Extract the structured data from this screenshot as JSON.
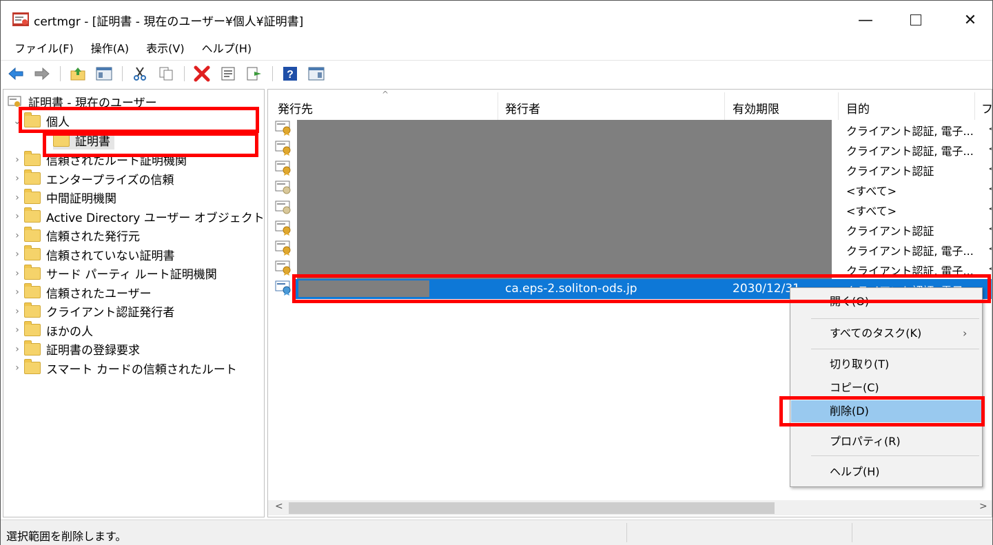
{
  "window": {
    "title": "certmgr - [証明書 - 現在のユーザー¥個人¥証明書]",
    "min_glyph": "—",
    "close_glyph": "✕"
  },
  "menu": [
    "ファイル(F)",
    "操作(A)",
    "表示(V)",
    "ヘルプ(H)"
  ],
  "toolbar": {
    "icons": [
      "back-arrow-icon",
      "forward-arrow-icon",
      "up-folder-icon",
      "show-hide-tree-icon",
      "cut-icon",
      "copy-icon",
      "delete-icon",
      "properties-icon",
      "export-icon",
      "help-icon",
      "console-icon"
    ]
  },
  "tree": {
    "root": "証明書 - 現在のユーザー",
    "expanded": "個人",
    "child": "証明書",
    "items": [
      "信頼されたルート証明機関",
      "エンタープライズの信頼",
      "中間証明機関",
      "Active Directory ユーザー オブジェクト",
      "信頼された発行元",
      "信頼されていない証明書",
      "サード パーティ ルート証明機関",
      "信頼されたユーザー",
      "クライアント認証発行者",
      "ほかの人",
      "証明書の登録要求",
      "スマート カードの信頼されたルート"
    ]
  },
  "list": {
    "columns": [
      "発行先",
      "発行者",
      "有効期限",
      "目的",
      "フ"
    ],
    "sort_caret": "^",
    "rows": [
      {
        "purpose": "クライアント認証, 電子...",
        "trail": "<"
      },
      {
        "purpose": "クライアント認証, 電子...",
        "trail": "<"
      },
      {
        "purpose": "クライアント認証",
        "trail": "<"
      },
      {
        "purpose": "<すべて>",
        "trail": "<"
      },
      {
        "purpose": "<すべて>",
        "trail": "<"
      },
      {
        "purpose": "クライアント認証",
        "trail": "<"
      },
      {
        "purpose": "クライアント認証, 電子...",
        "trail": "<"
      },
      {
        "purpose": "クライアント認証, 電子...",
        "trail": "<"
      }
    ],
    "selected": {
      "issuer": "ca.eps-2.soliton-ods.jp",
      "expiry": "2030/12/31",
      "purpose": "クライアント認証, 電子..."
    },
    "scroll_left": "<",
    "scroll_right": ">"
  },
  "context_menu": {
    "items": [
      "開く(O)",
      "すべてのタスク(K)",
      "切り取り(T)",
      "コピー(C)",
      "削除(D)",
      "プロパティ(R)",
      "ヘルプ(H)"
    ],
    "submenu_arrow": "›",
    "highlighted": "削除(D)"
  },
  "status": {
    "text": "選択範囲を削除します。"
  },
  "colors": {
    "selection": "#0e78d7",
    "menu_hover": "#99c9ef",
    "annotation": "#ff0000"
  }
}
